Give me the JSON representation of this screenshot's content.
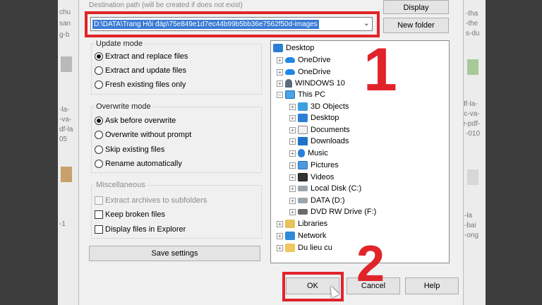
{
  "background": {
    "left_fragments": [
      "chu",
      "san",
      "g-b",
      "-la-",
      "-va-",
      "df-la",
      "05",
      "-1"
    ],
    "right_fragments": [
      "-tha",
      "-the",
      "s-du",
      "df-la-",
      "-c-va-",
      "e-pdf-",
      "-010",
      "-la",
      "-bai",
      "-ong"
    ]
  },
  "dialog": {
    "destination_label": "Destination path (will be created if does not exist)",
    "destination_value": "D:\\DATA\\Trang Hỏi đáp\\75e849e1d7ec44b99b5bb36e7562f50d-images",
    "display_button": "Display",
    "new_folder_button": "New folder",
    "update_mode": {
      "title": "Update mode",
      "options": [
        "Extract and replace files",
        "Extract and update files",
        "Fresh existing files only"
      ],
      "selected": "Extract and replace files"
    },
    "overwrite_mode": {
      "title": "Overwrite mode",
      "options": [
        "Ask before overwrite",
        "Overwrite without prompt",
        "Skip existing files",
        "Rename automatically"
      ],
      "selected": "Ask before overwrite"
    },
    "miscellaneous": {
      "title": "Miscellaneous",
      "options": [
        {
          "label": "Extract archives to subfolders",
          "disabled": true
        },
        {
          "label": "Keep broken files",
          "disabled": false
        },
        {
          "label": "Display files in Explorer",
          "disabled": false
        }
      ]
    },
    "save_settings_button": "Save settings",
    "tree": [
      {
        "label": "Desktop",
        "icon": "desktop-icon"
      },
      {
        "label": "OneDrive",
        "icon": "cloud-icon"
      },
      {
        "label": "OneDrive",
        "icon": "cloud-icon"
      },
      {
        "label": "WINDOWS 10",
        "icon": "user-icon"
      },
      {
        "label": "This PC",
        "icon": "pc-icon"
      },
      {
        "label": "3D Objects",
        "icon": "3d-objects-icon"
      },
      {
        "label": "Desktop",
        "icon": "desktop-icon"
      },
      {
        "label": "Documents",
        "icon": "documents-icon"
      },
      {
        "label": "Downloads",
        "icon": "downloads-icon"
      },
      {
        "label": "Music",
        "icon": "music-icon"
      },
      {
        "label": "Pictures",
        "icon": "pictures-icon"
      },
      {
        "label": "Videos",
        "icon": "videos-icon"
      },
      {
        "label": "Local Disk (C:)",
        "icon": "disk-icon"
      },
      {
        "label": "DATA (D:)",
        "icon": "disk-icon"
      },
      {
        "label": "DVD RW Drive (F:)",
        "icon": "dvd-icon"
      },
      {
        "label": "Libraries",
        "icon": "libraries-icon"
      },
      {
        "label": "Network",
        "icon": "network-icon"
      },
      {
        "label": "Du lieu cu",
        "icon": "folder-icon"
      }
    ],
    "ok_button": "OK",
    "cancel_button": "Cancel",
    "help_button": "Help"
  },
  "annotations": {
    "step1": "1",
    "step2": "2",
    "color": "#e0242a"
  }
}
